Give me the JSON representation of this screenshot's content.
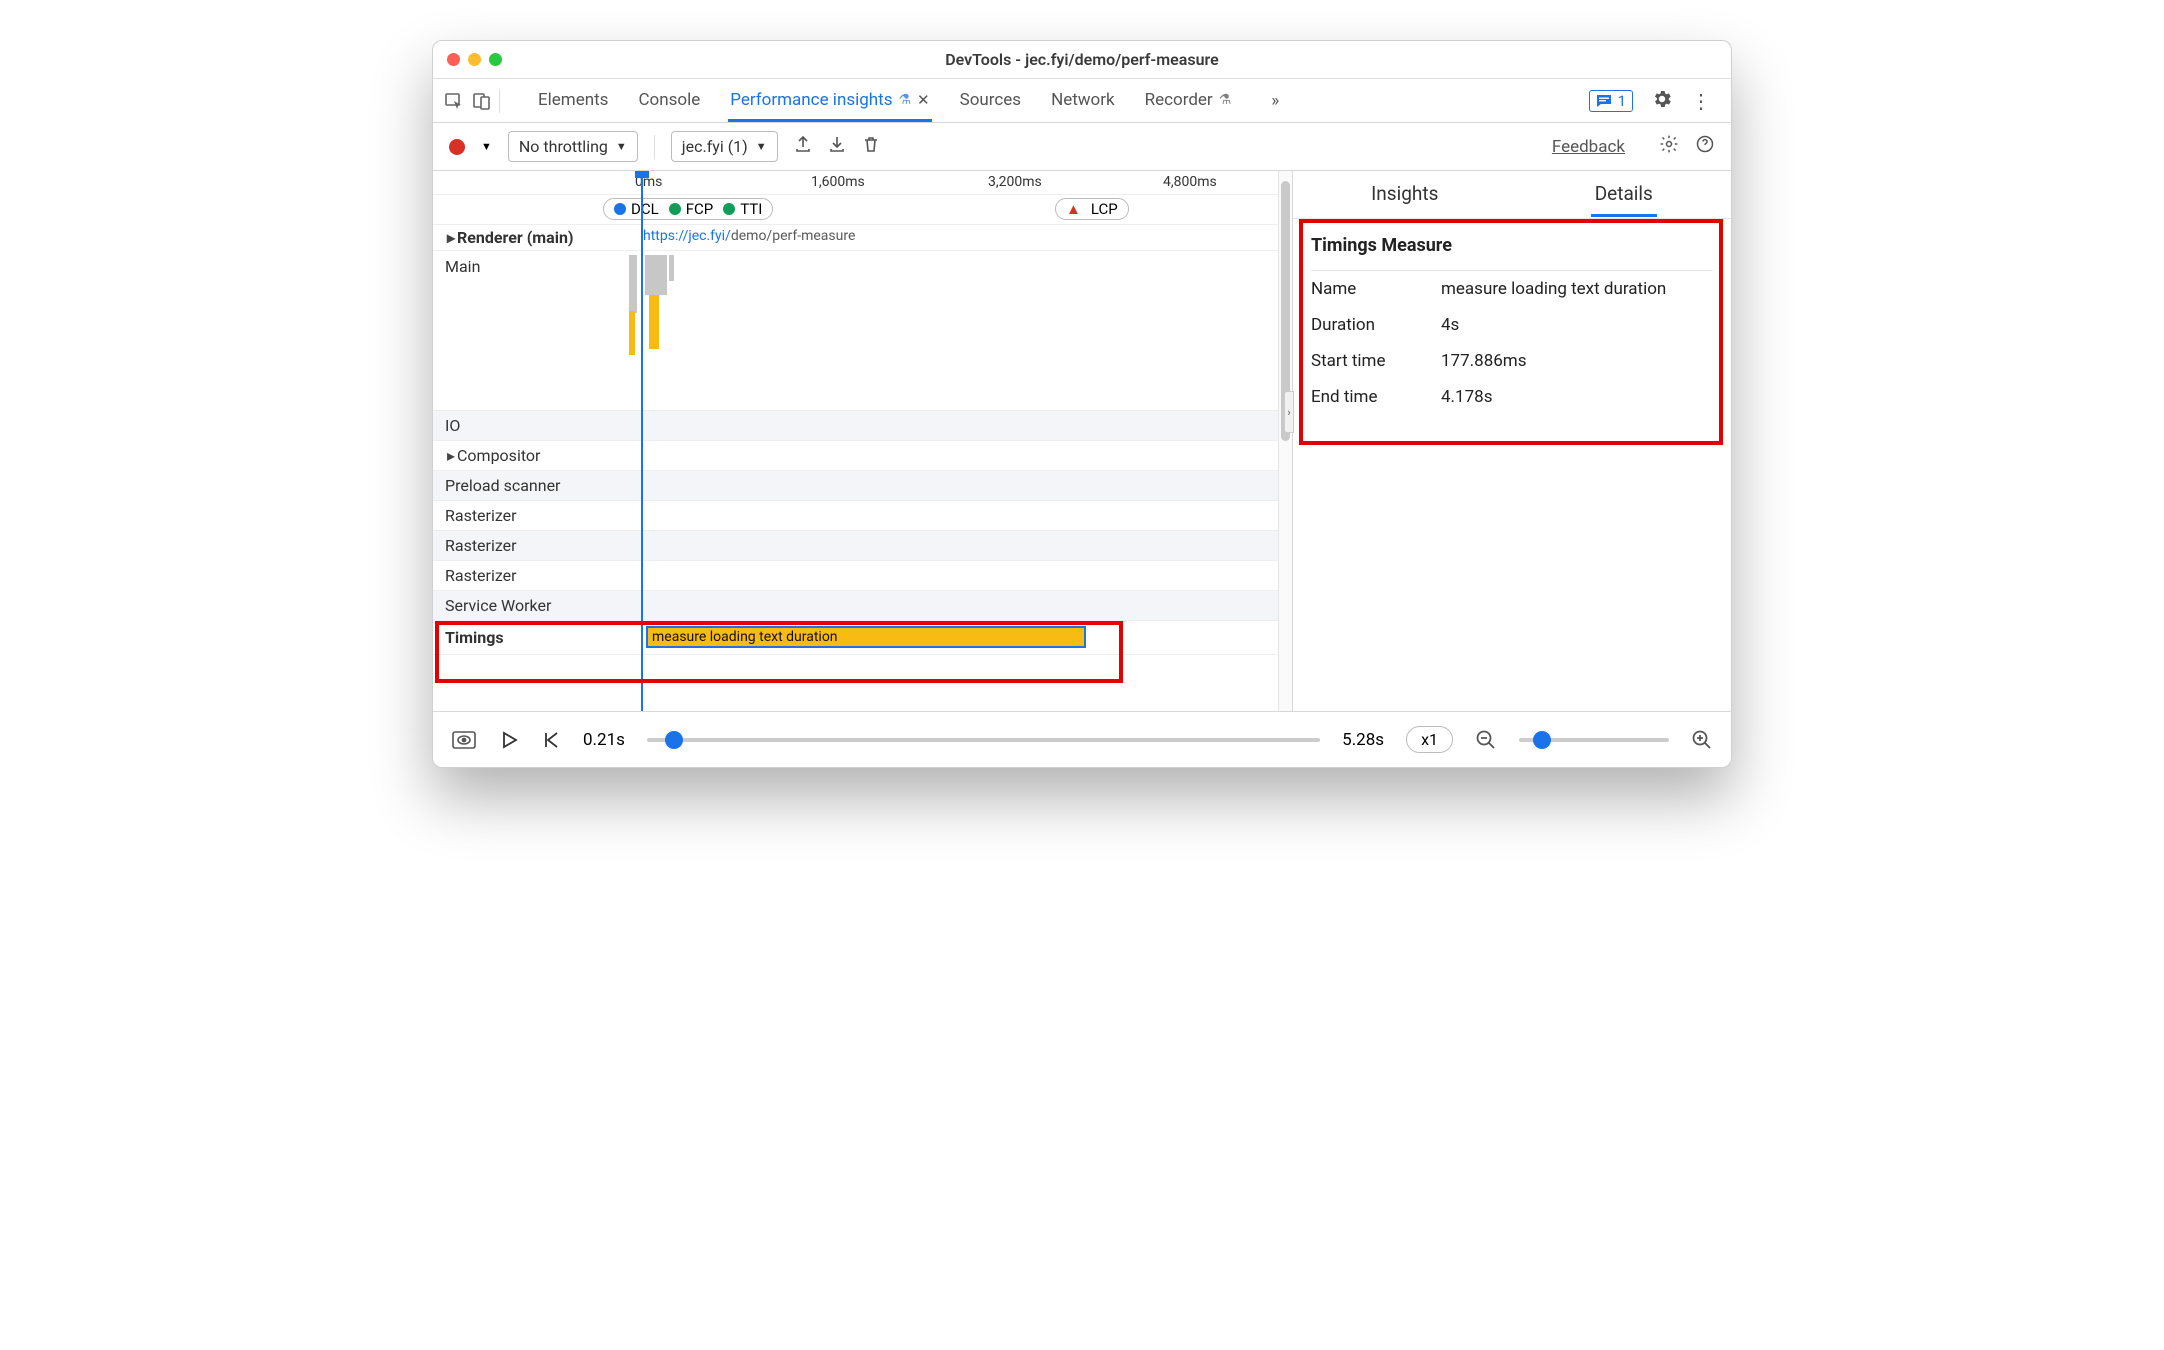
{
  "window_title": "DevTools - jec.fyi/demo/perf-measure",
  "tabs": {
    "elements": "Elements",
    "console": "Console",
    "perf_insights": "Performance insights",
    "sources": "Sources",
    "network": "Network",
    "recorder": "Recorder"
  },
  "issues_count": "1",
  "toolbar": {
    "throttling": "No throttling",
    "recording": "jec.fyi (1)",
    "feedback": "Feedback"
  },
  "timeline": {
    "ticks": [
      "0ms",
      "1,600ms",
      "3,200ms",
      "4,800ms"
    ],
    "markers": {
      "dcl": "DCL",
      "fcp": "FCP",
      "tti": "TTI",
      "lcp": "LCP"
    },
    "url_domain": "https://jec.fyi/",
    "url_path": "demo/perf-measure"
  },
  "tracks": {
    "renderer": "Renderer (main)",
    "main": "Main",
    "io": "IO",
    "compositor": "Compositor",
    "preload": "Preload scanner",
    "rasterizer": "Rasterizer",
    "service_worker": "Service Worker",
    "timings": "Timings"
  },
  "timings_bar_label": "measure loading text duration",
  "right_panel": {
    "tab_insights": "Insights",
    "tab_details": "Details",
    "heading": "Timings Measure",
    "rows": {
      "name_k": "Name",
      "name_v": "measure loading text duration",
      "duration_k": "Duration",
      "duration_v": "4s",
      "start_k": "Start time",
      "start_v": "177.886ms",
      "end_k": "End time",
      "end_v": "4.178s"
    }
  },
  "footer": {
    "start": "0.21s",
    "end": "5.28s",
    "speed": "x1"
  }
}
